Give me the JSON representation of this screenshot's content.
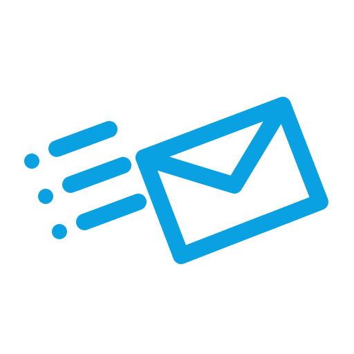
{
  "icon": {
    "name": "send-mail-icon",
    "color": "#0AA1E2",
    "background": "#FFFFFF"
  }
}
